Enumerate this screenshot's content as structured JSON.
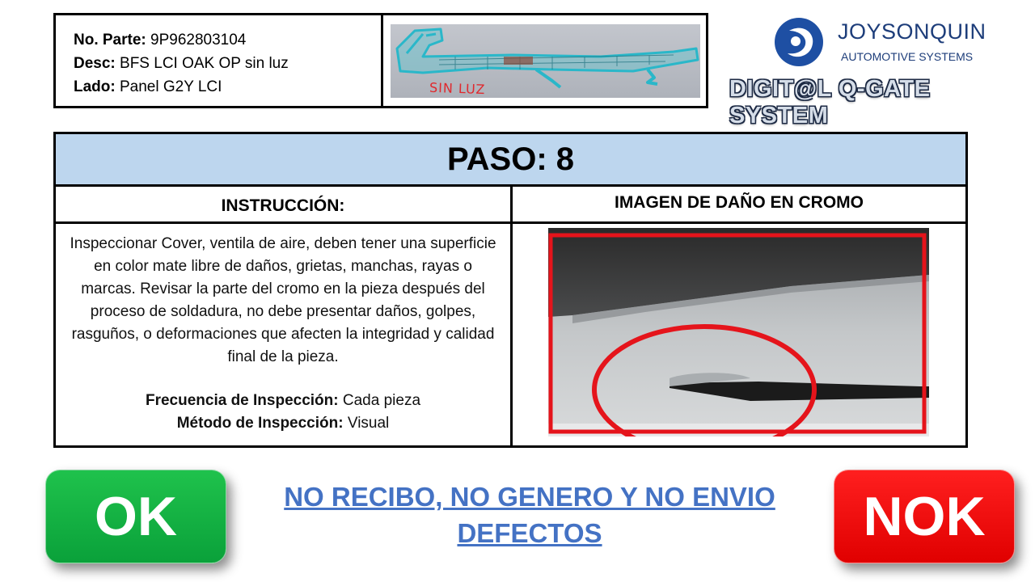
{
  "header": {
    "part_no_label": "No. Parte:",
    "part_no_value": "9P962803104",
    "desc_label": "Desc:",
    "desc_value": "BFS LCI OAK OP sin luz",
    "side_label": "Lado:",
    "side_value": "Panel G2Y LCI",
    "photo_annotation": "SIN LUZ"
  },
  "logo": {
    "company": "JOYSONQUIN",
    "subtitle": "AUTOMOTIVE SYSTEMS",
    "system": "DIGIT@L Q-GATE SYSTEM",
    "brand_color": "#1d3d7a"
  },
  "step": {
    "title": "PASO: 8",
    "instruction_header": "INSTRUCCIÓN:",
    "image_header": "IMAGEN DE DAÑO EN CROMO",
    "instruction_text": "Inspeccionar Cover, ventila de aire, deben tener una superficie en color mate libre de daños, grietas, manchas, rayas o marcas. Revisar la parte del cromo en la pieza después del proceso de soldadura, no debe presentar daños, golpes, rasguños, o deformaciones que afecten la integridad y calidad final de la pieza.",
    "frequency_label": "Frecuencia de Inspección:",
    "frequency_value": "Cada pieza",
    "method_label": "Método de Inspección:",
    "method_value": "Visual",
    "header_bg": "#bdd6ee"
  },
  "actions": {
    "ok_label": "OK",
    "nok_label": "NOK",
    "policy_line1": "NO RECIBO, NO GENERO Y NO ENVIO",
    "policy_line2": "DEFECTOS",
    "ok_color": "#12b046",
    "nok_color": "#ff0000",
    "policy_color": "#4472c4"
  }
}
